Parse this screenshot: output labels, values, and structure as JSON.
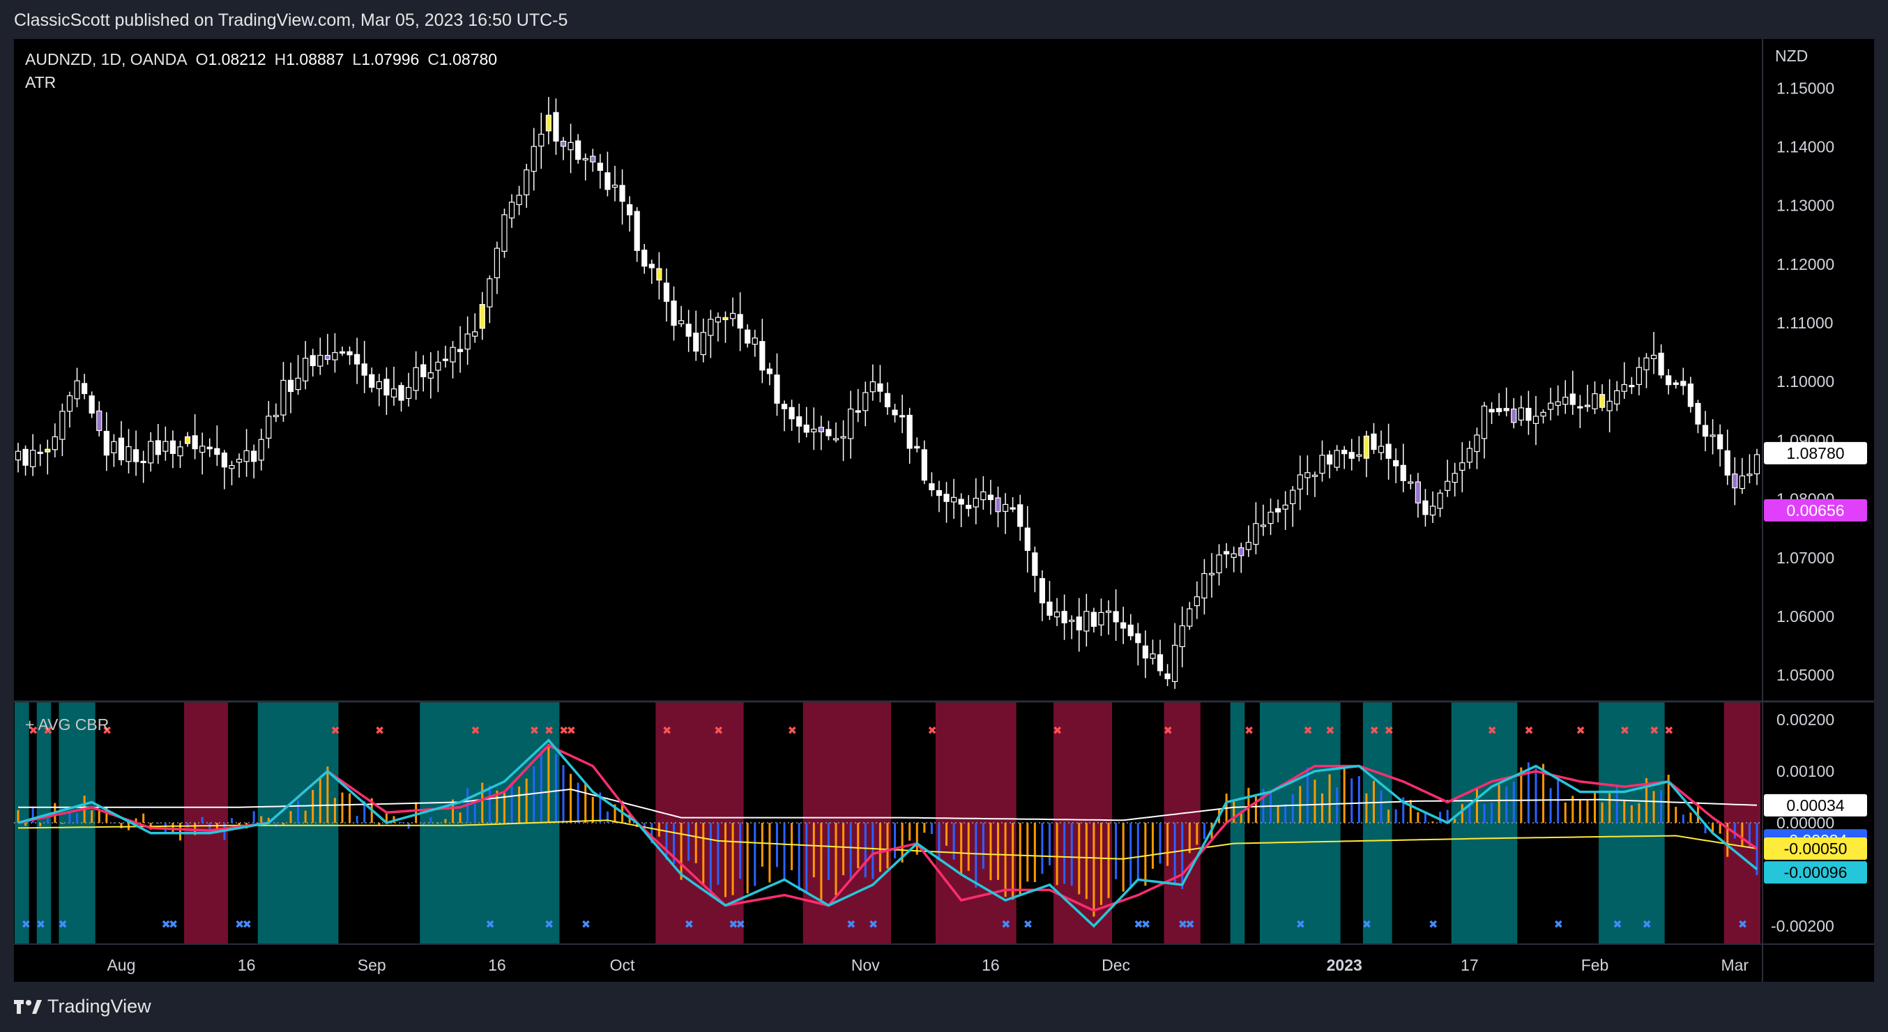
{
  "publisher": "ClassicScott published on TradingView.com, Mar 05, 2023 16:50 UTC-5",
  "brand": "TradingView",
  "brand_icon": "tradingview-logo-icon",
  "legend": {
    "symbol": "AUDNZD, 1D, OANDA",
    "o_label": "O",
    "o": "1.08212",
    "h_label": "H",
    "h": "1.08887",
    "l_label": "L",
    "l": "1.07996",
    "c_label": "C",
    "c": "1.08780",
    "indicator": "ATR"
  },
  "indicator_title": "+ AVG CBR",
  "colors": {
    "up_candle": "#ffffff",
    "highlight_yellow": "#ffeb3b",
    "highlight_purple": "#9575cd",
    "bull_zone": "#006064",
    "bear_zone": "#730f2e",
    "hist_orange": "#ff9800",
    "hist_blue": "#2962ff",
    "fast_line": "#26c6da",
    "slow_line": "#ff2d6f",
    "atr_price": "#e040fb"
  },
  "chart_data": [
    {
      "type": "candlestick",
      "currency": "NZD",
      "price_ticks": [
        "1.15000",
        "1.14000",
        "1.13000",
        "1.12000",
        "1.11000",
        "1.10000",
        "1.09000",
        "1.08000",
        "1.07000",
        "1.06000",
        "1.05000"
      ],
      "ylim": [
        1.0455,
        1.1555
      ],
      "last_price_label": "1.08780",
      "atr_label": "0.00656",
      "x_ticks": [
        "Aug",
        "16",
        "Sep",
        "16",
        "Oct",
        "Nov",
        "16",
        "Dec",
        "2023",
        "17",
        "Feb",
        "Mar"
      ],
      "close_anchors": [
        [
          0,
          1.087
        ],
        [
          4,
          1.0875
        ],
        [
          8,
          1.099
        ],
        [
          12,
          1.0885
        ],
        [
          16,
          1.0875
        ],
        [
          20,
          1.089
        ],
        [
          24,
          1.0895
        ],
        [
          28,
          1.087
        ],
        [
          32,
          1.088
        ],
        [
          36,
          1.0985
        ],
        [
          40,
          1.104
        ],
        [
          44,
          1.105
        ],
        [
          48,
          1.1
        ],
        [
          52,
          1.0985
        ],
        [
          56,
          1.103
        ],
        [
          60,
          1.105
        ],
        [
          63,
          1.112
        ],
        [
          66,
          1.127
        ],
        [
          69,
          1.136
        ],
        [
          72,
          1.144
        ],
        [
          75,
          1.14
        ],
        [
          78,
          1.136
        ],
        [
          81,
          1.132
        ],
        [
          84,
          1.124
        ],
        [
          88,
          1.113
        ],
        [
          92,
          1.106
        ],
        [
          96,
          1.112
        ],
        [
          100,
          1.106
        ],
        [
          104,
          1.095
        ],
        [
          108,
          1.091
        ],
        [
          112,
          1.092
        ],
        [
          116,
          1.1
        ],
        [
          120,
          1.093
        ],
        [
          124,
          1.082
        ],
        [
          128,
          1.078
        ],
        [
          132,
          1.08
        ],
        [
          136,
          1.076
        ],
        [
          140,
          1.06
        ],
        [
          144,
          1.059
        ],
        [
          148,
          1.061
        ],
        [
          152,
          1.056
        ],
        [
          156,
          1.05
        ],
        [
          159,
          1.063
        ],
        [
          163,
          1.07
        ],
        [
          167,
          1.074
        ],
        [
          171,
          1.078
        ],
        [
          175,
          1.085
        ],
        [
          179,
          1.087
        ],
        [
          183,
          1.09
        ],
        [
          187,
          1.086
        ],
        [
          191,
          1.077
        ],
        [
          195,
          1.083
        ],
        [
          199,
          1.095
        ],
        [
          203,
          1.094
        ],
        [
          207,
          1.094
        ],
        [
          211,
          1.097
        ],
        [
          215,
          1.097
        ],
        [
          219,
          1.1
        ],
        [
          222,
          1.104
        ],
        [
          226,
          1.098
        ],
        [
          230,
          1.09
        ],
        [
          233,
          1.082
        ],
        [
          236,
          1.0878
        ]
      ],
      "highlight_yellow_bars": [
        4,
        23,
        63,
        72,
        87,
        96,
        183,
        215
      ],
      "highlight_purple_bars": [
        11,
        42,
        74,
        78,
        109,
        133,
        166,
        190,
        203,
        213,
        233
      ]
    },
    {
      "type": "histogram_with_lines",
      "ylim": [
        -0.00235,
        0.00235
      ],
      "ticks": [
        "0.00200",
        "0.00100",
        "0.00000",
        "-0.00200"
      ],
      "labels": {
        "white_line": "0.00034",
        "blue_hist": "-0.00034",
        "yellow_line": "-0.00050",
        "cyan_line": "-0.00096"
      },
      "fast_anchors": [
        [
          0,
          0.0
        ],
        [
          10,
          0.0004
        ],
        [
          18,
          -0.0002
        ],
        [
          26,
          -0.0002
        ],
        [
          34,
          0.0
        ],
        [
          42,
          0.001
        ],
        [
          50,
          0.0
        ],
        [
          60,
          0.0004
        ],
        [
          66,
          0.0008
        ],
        [
          72,
          0.0016
        ],
        [
          78,
          0.0006
        ],
        [
          84,
          0.0
        ],
        [
          90,
          -0.001
        ],
        [
          96,
          -0.0016
        ],
        [
          104,
          -0.0011
        ],
        [
          110,
          -0.0016
        ],
        [
          116,
          -0.0012
        ],
        [
          122,
          -0.0004
        ],
        [
          128,
          -0.001
        ],
        [
          134,
          -0.0015
        ],
        [
          140,
          -0.0012
        ],
        [
          146,
          -0.002
        ],
        [
          152,
          -0.0011
        ],
        [
          158,
          -0.0012
        ],
        [
          164,
          0.0004
        ],
        [
          170,
          0.0006
        ],
        [
          176,
          0.001
        ],
        [
          182,
          0.0011
        ],
        [
          188,
          0.0004
        ],
        [
          194,
          0.0
        ],
        [
          200,
          0.0007
        ],
        [
          206,
          0.0011
        ],
        [
          212,
          0.0006
        ],
        [
          218,
          0.0006
        ],
        [
          224,
          0.0008
        ],
        [
          230,
          -0.0002
        ],
        [
          236,
          -0.0009
        ]
      ],
      "slow_anchors": [
        [
          0,
          0.0
        ],
        [
          10,
          0.0003
        ],
        [
          18,
          -0.0001
        ],
        [
          26,
          -0.00015
        ],
        [
          34,
          0.0
        ],
        [
          42,
          0.001
        ],
        [
          50,
          0.0002
        ],
        [
          60,
          0.0003
        ],
        [
          66,
          0.0006
        ],
        [
          72,
          0.0015
        ],
        [
          78,
          0.0011
        ],
        [
          84,
          0.0
        ],
        [
          90,
          -0.0008
        ],
        [
          96,
          -0.0016
        ],
        [
          104,
          -0.0014
        ],
        [
          110,
          -0.0016
        ],
        [
          116,
          -0.0006
        ],
        [
          122,
          -0.0004
        ],
        [
          128,
          -0.0015
        ],
        [
          134,
          -0.0013
        ],
        [
          140,
          -0.0013
        ],
        [
          146,
          -0.0017
        ],
        [
          152,
          -0.0014
        ],
        [
          158,
          -0.001
        ],
        [
          164,
          0.0
        ],
        [
          170,
          0.0006
        ],
        [
          176,
          0.0011
        ],
        [
          182,
          0.0011
        ],
        [
          188,
          0.0008
        ],
        [
          194,
          0.0004
        ],
        [
          200,
          0.0008
        ],
        [
          206,
          0.001
        ],
        [
          212,
          0.0008
        ],
        [
          218,
          0.0007
        ],
        [
          224,
          0.0008
        ],
        [
          230,
          0.0001
        ],
        [
          236,
          -0.0005
        ]
      ],
      "white_anchors": [
        [
          0,
          0.0003
        ],
        [
          30,
          0.0003
        ],
        [
          60,
          0.0004
        ],
        [
          75,
          0.00065
        ],
        [
          90,
          0.0001
        ],
        [
          120,
          0.0001
        ],
        [
          150,
          5e-05
        ],
        [
          165,
          0.0003
        ],
        [
          190,
          0.00042
        ],
        [
          215,
          0.00045
        ],
        [
          236,
          0.00034
        ]
      ],
      "yellow_anchors": [
        [
          0,
          -0.0001
        ],
        [
          30,
          -5e-05
        ],
        [
          60,
          -5e-05
        ],
        [
          80,
          5e-05
        ],
        [
          95,
          -0.00035
        ],
        [
          130,
          -0.0006
        ],
        [
          150,
          -0.0007
        ],
        [
          165,
          -0.0004
        ],
        [
          200,
          -0.0003
        ],
        [
          225,
          -0.00025
        ],
        [
          236,
          -0.0005
        ]
      ],
      "zones": [
        {
          "type": "bull",
          "from": 0,
          "to": 1
        },
        {
          "type": "bull",
          "from": 3,
          "to": 4
        },
        {
          "type": "bull",
          "from": 6,
          "to": 10
        },
        {
          "type": "bear",
          "from": 23,
          "to": 28
        },
        {
          "type": "bull",
          "from": 33,
          "to": 43
        },
        {
          "type": "bull",
          "from": 55,
          "to": 73
        },
        {
          "type": "bear",
          "from": 87,
          "to": 98
        },
        {
          "type": "bear",
          "from": 107,
          "to": 118
        },
        {
          "type": "bear",
          "from": 125,
          "to": 135
        },
        {
          "type": "bear",
          "from": 141,
          "to": 148
        },
        {
          "type": "bear",
          "from": 156,
          "to": 160
        },
        {
          "type": "bull",
          "from": 165,
          "to": 166
        },
        {
          "type": "bull",
          "from": 169,
          "to": 179
        },
        {
          "type": "bull",
          "from": 183,
          "to": 186
        },
        {
          "type": "bull",
          "from": 195,
          "to": 203
        },
        {
          "type": "bull",
          "from": 215,
          "to": 223
        },
        {
          "type": "bear",
          "from": 232,
          "to": 236
        }
      ],
      "top_markers": [
        2,
        4,
        12,
        43,
        49,
        62,
        70,
        72,
        74,
        75,
        88,
        95,
        105,
        124,
        141,
        156,
        167,
        175,
        178,
        184,
        186,
        200,
        205,
        212,
        218,
        222,
        224
      ],
      "bottom_markers": [
        1,
        3,
        6,
        20,
        21,
        30,
        31,
        64,
        72,
        77,
        91,
        97,
        98,
        113,
        116,
        134,
        137,
        152,
        153,
        158,
        159,
        174,
        183,
        192,
        209,
        217,
        221,
        234
      ]
    }
  ]
}
